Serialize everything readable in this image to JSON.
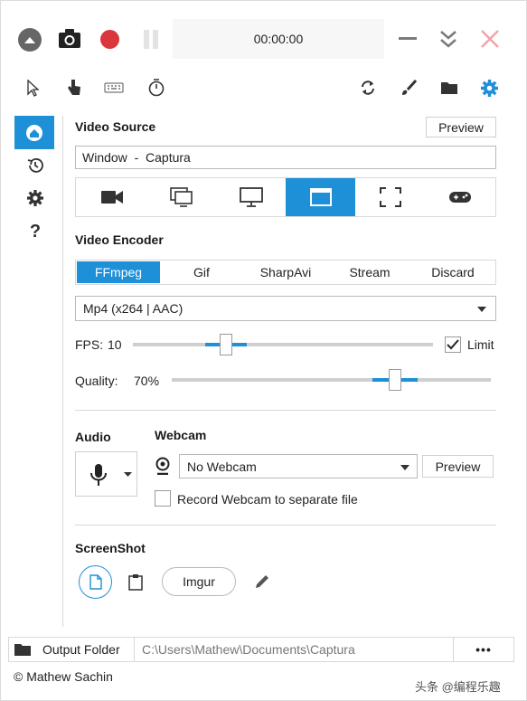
{
  "titlebar": {
    "timer": "00:00:00"
  },
  "colors": {
    "accent": "#1e90d8",
    "record": "#d9363e",
    "close": "#f4a3a6"
  },
  "video_source": {
    "title": "Video Source",
    "preview_label": "Preview",
    "value": "Window  -  Captura"
  },
  "video_encoder": {
    "title": "Video Encoder",
    "tabs": [
      "FFmpeg",
      "Gif",
      "SharpAvi",
      "Stream",
      "Discard"
    ],
    "selected_tab": "FFmpeg",
    "codec": "Mp4 (x264 | AAC)",
    "fps_label": "FPS:",
    "fps_value": "10",
    "fps_fraction": 0.31,
    "limit_label": "Limit",
    "limit_checked": true,
    "quality_label": "Quality:",
    "quality_value": "70%",
    "quality_fraction": 0.7
  },
  "audio": {
    "title": "Audio"
  },
  "webcam": {
    "title": "Webcam",
    "selected": "No Webcam",
    "preview_label": "Preview",
    "separate_file_label": "Record Webcam to separate file",
    "separate_file_checked": false
  },
  "screenshot": {
    "title": "ScreenShot",
    "imgur_label": "Imgur"
  },
  "output": {
    "label": "Output Folder",
    "path": "C:\\Users\\Mathew\\Documents\\Captura",
    "more_label": "•••"
  },
  "footer": {
    "credit": "© Mathew Sachin",
    "watermark": "头条 @编程乐趣"
  }
}
